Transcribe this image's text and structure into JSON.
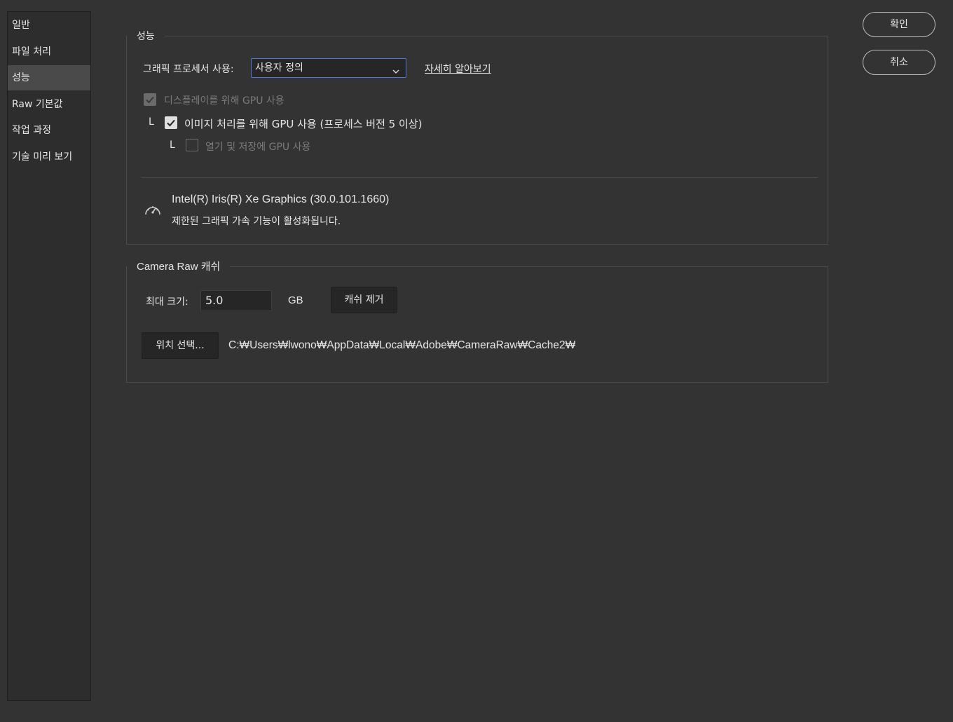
{
  "sidebar": {
    "items": [
      {
        "label": "일반"
      },
      {
        "label": "파일 처리"
      },
      {
        "label": "성능",
        "active": true
      },
      {
        "label": "Raw 기본값"
      },
      {
        "label": "작업 과정"
      },
      {
        "label": "기술 미리 보기"
      }
    ]
  },
  "performance": {
    "legend": "성능",
    "gpu_label": "그래픽 프로세서 사용:",
    "gpu_select_value": "사용자 정의",
    "learn_more": "자세히 알아보기",
    "cb_display": {
      "label": "디스플레이를 위해 GPU 사용",
      "checked": true,
      "disabled": true
    },
    "cb_image": {
      "label": "이미지 처리를 위해 GPU 사용 (프로세스 버전 5 이상)",
      "checked": true
    },
    "cb_open_save": {
      "label": "열기 및 저장에 GPU 사용",
      "checked": false,
      "disabled": true
    },
    "tree_marker": "L",
    "gpu_name": "Intel(R) Iris(R) Xe Graphics (30.0.101.1660)",
    "gpu_status": "제한된 그래픽 가속 기능이 활성화됩니다."
  },
  "cache": {
    "legend": "Camera Raw 캐쉬",
    "max_size_label": "최대 크기:",
    "max_size_value": "5.0",
    "unit": "GB",
    "purge_button": "캐쉬 제거",
    "choose_location_button": "위치 선택...",
    "path": "C:₩Users₩lwono₩AppData₩Local₩Adobe₩CameraRaw₩Cache2₩"
  },
  "actions": {
    "ok": "확인",
    "cancel": "취소"
  },
  "colors": {
    "background": "#333333",
    "sidebar_active": "#4a4a4a",
    "select_focus": "#4b7bd6"
  }
}
